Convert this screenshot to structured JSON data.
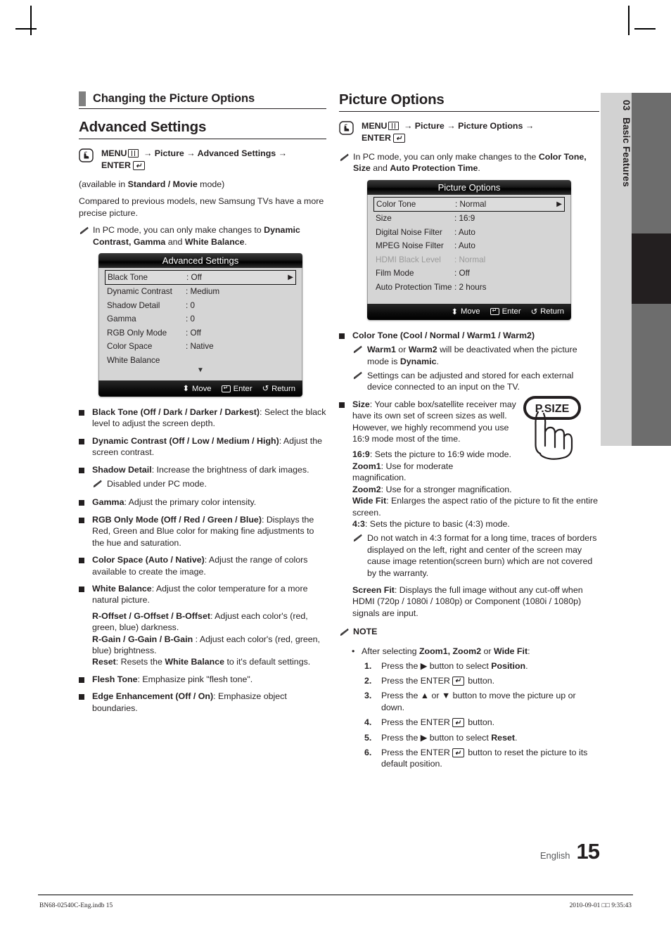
{
  "side_tab": {
    "number": "03",
    "label": "Basic Features"
  },
  "left": {
    "section_heading": "Changing the Picture Options",
    "title": "Advanced Settings",
    "menu_path": {
      "menu_label": "MENU",
      "arrow1": "→",
      "item1": "Picture",
      "arrow2": "→",
      "item2": "Advanced Settings",
      "arrow3": "→",
      "enter_label": "ENTER"
    },
    "intro_1": "(available in ",
    "intro_1_bold": "Standard / Movie",
    "intro_1_end": " mode)",
    "intro_2": "Compared to previous models, new Samsung TVs have a more precise picture.",
    "note_pc_mode": {
      "pre": "In PC mode, you can only make changes to ",
      "bold": "Dynamic Contrast, Gamma",
      "mid": " and ",
      "bold2": "White Balance",
      "end": "."
    },
    "osd": {
      "title": "Advanced Settings",
      "rows": [
        {
          "label": "Black Tone",
          "value": ": Off",
          "selected": true,
          "caret": "▶"
        },
        {
          "label": "Dynamic Contrast",
          "value": ": Medium",
          "selected": false
        },
        {
          "label": "Shadow Detail",
          "value": ": 0",
          "selected": false
        },
        {
          "label": "Gamma",
          "value": ": 0",
          "selected": false
        },
        {
          "label": "RGB Only Mode",
          "value": ": Off",
          "selected": false
        },
        {
          "label": "Color Space",
          "value": ": Native",
          "selected": false
        },
        {
          "label": "White Balance",
          "value": "",
          "selected": false
        }
      ],
      "more_indicator": "▼",
      "footer": {
        "move": "Move",
        "enter": "Enter",
        "return": "Return",
        "return_icon": "↺",
        "move_icon": "⬍"
      }
    },
    "bullets": [
      {
        "bold": "Black Tone (Off / Dark / Darker / Darkest)",
        "rest": ": Select the black level to adjust the screen depth."
      },
      {
        "bold": "Dynamic Contrast (Off / Low / Medium / High)",
        "rest": ": Adjust the screen contrast."
      },
      {
        "bold": "Shadow Detail",
        "rest": ": Increase the brightness of dark images.",
        "note": "Disabled under PC mode."
      },
      {
        "bold": "Gamma",
        "rest": ": Adjust the primary color intensity."
      },
      {
        "bold": "RGB Only Mode (Off / Red / Green / Blue)",
        "rest": ": Displays the Red, Green and Blue color for making fine adjustments to the hue and saturation."
      },
      {
        "bold": "Color Space (Auto / Native)",
        "rest": ": Adjust the range of colors available to create the image."
      },
      {
        "bold": "White Balance",
        "rest": ": Adjust the color temperature for a more natural picture."
      },
      {
        "bold": "Flesh Tone",
        "rest": ": Emphasize pink \"flesh tone\"."
      },
      {
        "bold": "Edge Enhancement (Off / On)",
        "rest": ": Emphasize object boundaries."
      }
    ],
    "white_balance_sub": [
      {
        "bold": "R-Offset / G-Offset / B-Offset",
        "rest": ": Adjust each color's (red, green, blue) darkness."
      },
      {
        "bold": "R-Gain / G-Gain / B-Gain",
        "rest": " : Adjust each color's (red, green, blue) brightness."
      },
      {
        "bold": "Reset",
        "rest": ": Resets the ",
        "bold2": "White Balance",
        "rest2": " to it's default settings."
      }
    ]
  },
  "right": {
    "title": "Picture Options",
    "menu_path": {
      "menu_label": "MENU",
      "arrow1": "→",
      "item1": "Picture",
      "arrow2": "→",
      "item2": "Picture Options",
      "arrow3": "→",
      "enter_label": "ENTER"
    },
    "note_pc_mode": {
      "pre": "In PC mode, you can only make changes to the ",
      "bold": "Color Tone, Size",
      "mid": " and ",
      "bold2": "Auto Protection Time",
      "end": "."
    },
    "osd": {
      "title": "Picture Options",
      "rows": [
        {
          "label": "Color Tone",
          "value": ": Normal",
          "selected": true,
          "caret": "▶"
        },
        {
          "label": "Size",
          "value": ": 16:9",
          "selected": false
        },
        {
          "label": "Digital Noise Filter",
          "value": ": Auto",
          "selected": false
        },
        {
          "label": "MPEG Noise Filter",
          "value": ": Auto",
          "selected": false
        },
        {
          "label": "HDMI Black Level",
          "value": ": Normal",
          "selected": false,
          "dim": true
        },
        {
          "label": "Film Mode",
          "value": ": Off",
          "selected": false
        },
        {
          "label": "Auto Protection Time",
          "value": ": 2 hours",
          "selected": false
        }
      ],
      "footer": {
        "move": "Move",
        "enter": "Enter",
        "return": "Return",
        "return_icon": "↺",
        "move_icon": "⬍"
      }
    },
    "color_tone": {
      "bold": "Color Tone (Cool / Normal / Warm1 / Warm2)",
      "note1": {
        "b1": "Warm1",
        "mid1": " or ",
        "b2": "Warm2",
        "mid2": " will be deactivated when the picture mode is ",
        "b3": "Dynamic",
        "end": "."
      },
      "note2": "Settings can be adjusted and stored for each external device connected to an input on the TV."
    },
    "size": {
      "bold": "Size",
      "rest": ": Your cable box/satellite receiver may have its own set of screen sizes as well. However, we highly recommend you use 16:9 mode most of the time.",
      "modes": [
        {
          "bold": "16:9",
          "rest": ": Sets the picture to 16:9 wide mode."
        },
        {
          "bold": "Zoom1",
          "rest": ": Use for moderate magnification."
        },
        {
          "bold": "Zoom2",
          "rest": ": Use for a stronger magnification."
        },
        {
          "bold": "Wide Fit",
          "rest": ": Enlarges the aspect ratio of the picture to fit the entire screen."
        },
        {
          "bold": "4:3",
          "rest": ": Sets the picture to basic (4:3) mode."
        }
      ],
      "note_43": "Do not watch in 4:3 format for a long time, traces of borders displayed on the left, right and center of the screen may cause image retention(screen burn) which are not covered by the warranty.",
      "screen_fit": {
        "bold": "Screen Fit",
        "rest": ": Displays the full image without any cut-off when HDMI (720p / 1080i / 1080p) or Component (1080i / 1080p) signals are input."
      }
    },
    "note_block": {
      "title": "NOTE",
      "lead_pre": "After selecting ",
      "lead_bold": "Zoom1, Zoom2",
      "lead_mid": " or ",
      "lead_bold2": "Wide Fit",
      "lead_end": ":",
      "steps": [
        {
          "num": "1.",
          "pre": "Press the ▶ button to select ",
          "bold": "Position",
          "end": "."
        },
        {
          "num": "2.",
          "pre": "Press the ENTER",
          "enter_icon": true,
          "end": " button."
        },
        {
          "num": "3.",
          "pre": "Press the ▲ or ▼ button to move the picture up or down.",
          "end": ""
        },
        {
          "num": "4.",
          "pre": "Press the ENTER",
          "enter_icon": true,
          "end": " button."
        },
        {
          "num": "5.",
          "pre": "Press the ▶ button to select ",
          "bold": "Reset",
          "end": "."
        },
        {
          "num": "6.",
          "pre": "Press the ENTER",
          "enter_icon": true,
          "end": " button to reset the picture to its default position."
        }
      ]
    },
    "psize_button_label": "P.SIZE"
  },
  "footer": {
    "english_label": "English",
    "page_number": "15",
    "file_name": "BN68-02540C-Eng.indb   15",
    "timestamp": "2010-09-01   □□ 9:35:43"
  },
  "colors": {
    "accent_bar": "#808080",
    "osd_body": "#d5d5d5",
    "tab_light": "#d2d2d2",
    "tab_dark": "#6d6d6d"
  }
}
